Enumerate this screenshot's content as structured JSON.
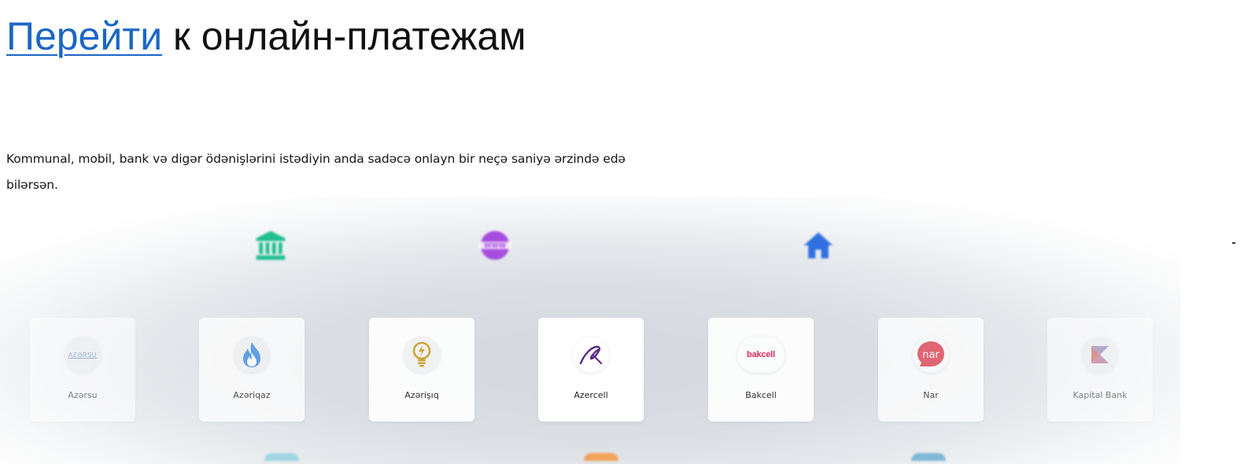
{
  "heading": {
    "link_text": "Перейти",
    "rest_text": " к онлайн-платежам"
  },
  "subtitle": "Kommunal, mobil, bank və digər ödənişlərini istədiyin anda sadəcə onlayn bir neçə saniyə ərzində edə bilərsən.",
  "categories": [
    {
      "icon": "bank-icon",
      "color": "#1fbf8f"
    },
    {
      "icon": "www-globe-icon",
      "color": "#a64de0"
    },
    {
      "icon": "home-icon",
      "color": "#2f6fe0"
    }
  ],
  "providers": [
    {
      "label": "Azərsu",
      "logo": "azersu-logo",
      "logo_text": "AZƏRSU"
    },
    {
      "label": "Azəriqaz",
      "logo": "azeriqaz-flame-logo"
    },
    {
      "label": "Azərişıq",
      "logo": "azerishiq-bulb-logo"
    },
    {
      "label": "Azercell",
      "logo": "azercell-logo"
    },
    {
      "label": "Bakcell",
      "logo": "bakcell-logo",
      "logo_text": "bakcell"
    },
    {
      "label": "Nar",
      "logo": "nar-logo",
      "logo_text": "nar"
    },
    {
      "label": "Kapital Bank",
      "logo": "kapital-bank-logo"
    }
  ],
  "colors": {
    "link": "#1b67c4",
    "bakcell": "#e0204f",
    "nar": "#e04452",
    "azercell": "#5b2a86",
    "azeriqaz": "#3b8fe0",
    "azerishiq": "#c9a227"
  }
}
